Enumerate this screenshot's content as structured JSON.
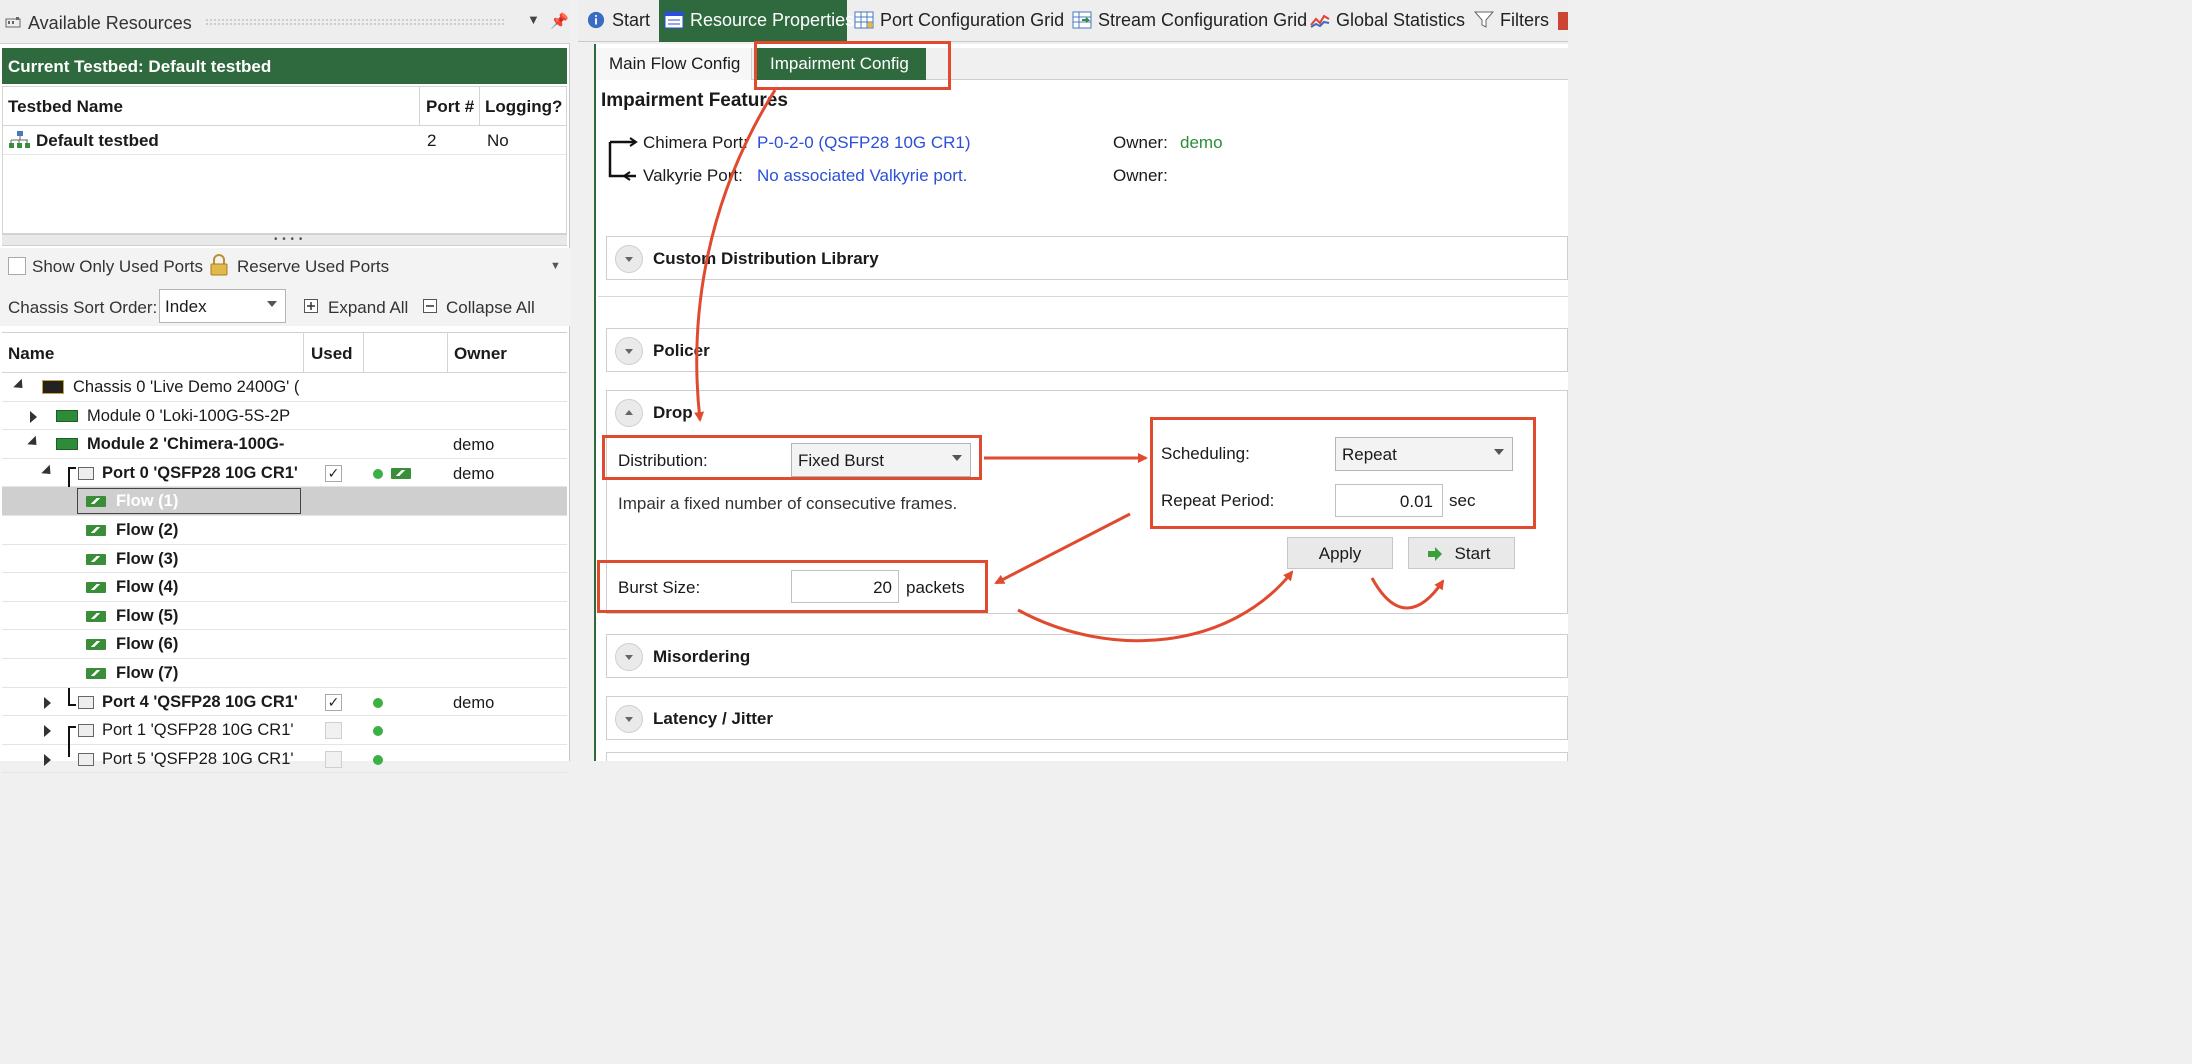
{
  "left": {
    "title": "Available Resources",
    "testbed_bar": "Current Testbed: Default testbed",
    "testbed_table": {
      "headers": [
        "Testbed Name",
        "Port #",
        "Logging?"
      ],
      "row": {
        "name": "Default testbed",
        "port": "2",
        "logging": "No"
      }
    },
    "filters": {
      "show_used": "Show Only Used Ports",
      "reserve_used": "Reserve Used Ports",
      "sort_label": "Chassis Sort Order:",
      "sort_value": "Index",
      "expand_all": "Expand All",
      "collapse_all": "Collapse All"
    },
    "tree": {
      "headers": [
        "Name",
        "Used",
        "",
        "Owner"
      ],
      "rows": [
        {
          "label": "Chassis 0 'Live Demo 2400G' (",
          "owner": ""
        },
        {
          "label": "Module 0 'Loki-100G-5S-2P",
          "owner": ""
        },
        {
          "label": "Module 2 'Chimera-100G-",
          "owner": "demo"
        },
        {
          "label": "Port 0 'QSFP28 10G CR1'",
          "owner": "demo"
        },
        {
          "label": "Flow (1)",
          "owner": ""
        },
        {
          "label": "Flow (2)",
          "owner": ""
        },
        {
          "label": "Flow (3)",
          "owner": ""
        },
        {
          "label": "Flow (4)",
          "owner": ""
        },
        {
          "label": "Flow (5)",
          "owner": ""
        },
        {
          "label": "Flow (6)",
          "owner": ""
        },
        {
          "label": "Flow (7)",
          "owner": ""
        },
        {
          "label": "Port 4 'QSFP28 10G CR1'",
          "owner": "demo"
        },
        {
          "label": "Port 1 'QSFP28 10G CR1'",
          "owner": ""
        },
        {
          "label": "Port 5 'QSFP28 10G CR1'",
          "owner": ""
        }
      ]
    }
  },
  "tabs": [
    "Start",
    "Resource Properties",
    "Port Configuration Grid",
    "Stream Configuration Grid",
    "Global Statistics",
    "Filters"
  ],
  "subtabs": [
    "Main Flow Config",
    "Impairment Config"
  ],
  "impairment": {
    "title": "Impairment Features",
    "chimera_label": "Chimera Port:",
    "chimera_value": "P-0-2-0 (QSFP28 10G CR1)",
    "owner_label": "Owner:",
    "owner_value": "demo",
    "valkyrie_label": "Valkyrie Port:",
    "valkyrie_value": "No associated Valkyrie port.",
    "owner2_label": "Owner:"
  },
  "sections": {
    "custom": "Custom Distribution Library",
    "policer": "Policer",
    "drop": "Drop",
    "misordering": "Misordering",
    "latency": "Latency / Jitter"
  },
  "drop": {
    "distribution_label": "Distribution:",
    "distribution_value": "Fixed Burst",
    "description": "Impair a fixed number of consecutive frames.",
    "burst_label": "Burst Size:",
    "burst_value": "20",
    "burst_unit": "packets",
    "scheduling_label": "Scheduling:",
    "scheduling_value": "Repeat",
    "repeat_label": "Repeat Period:",
    "repeat_value": "0.01",
    "repeat_unit": "sec",
    "apply": "Apply",
    "start": "Start"
  },
  "colors": {
    "brand_green": "#2f6a3e",
    "annotation_red": "#e04a2f",
    "link_blue": "#2b4fd8",
    "status_green": "#3cb043"
  }
}
